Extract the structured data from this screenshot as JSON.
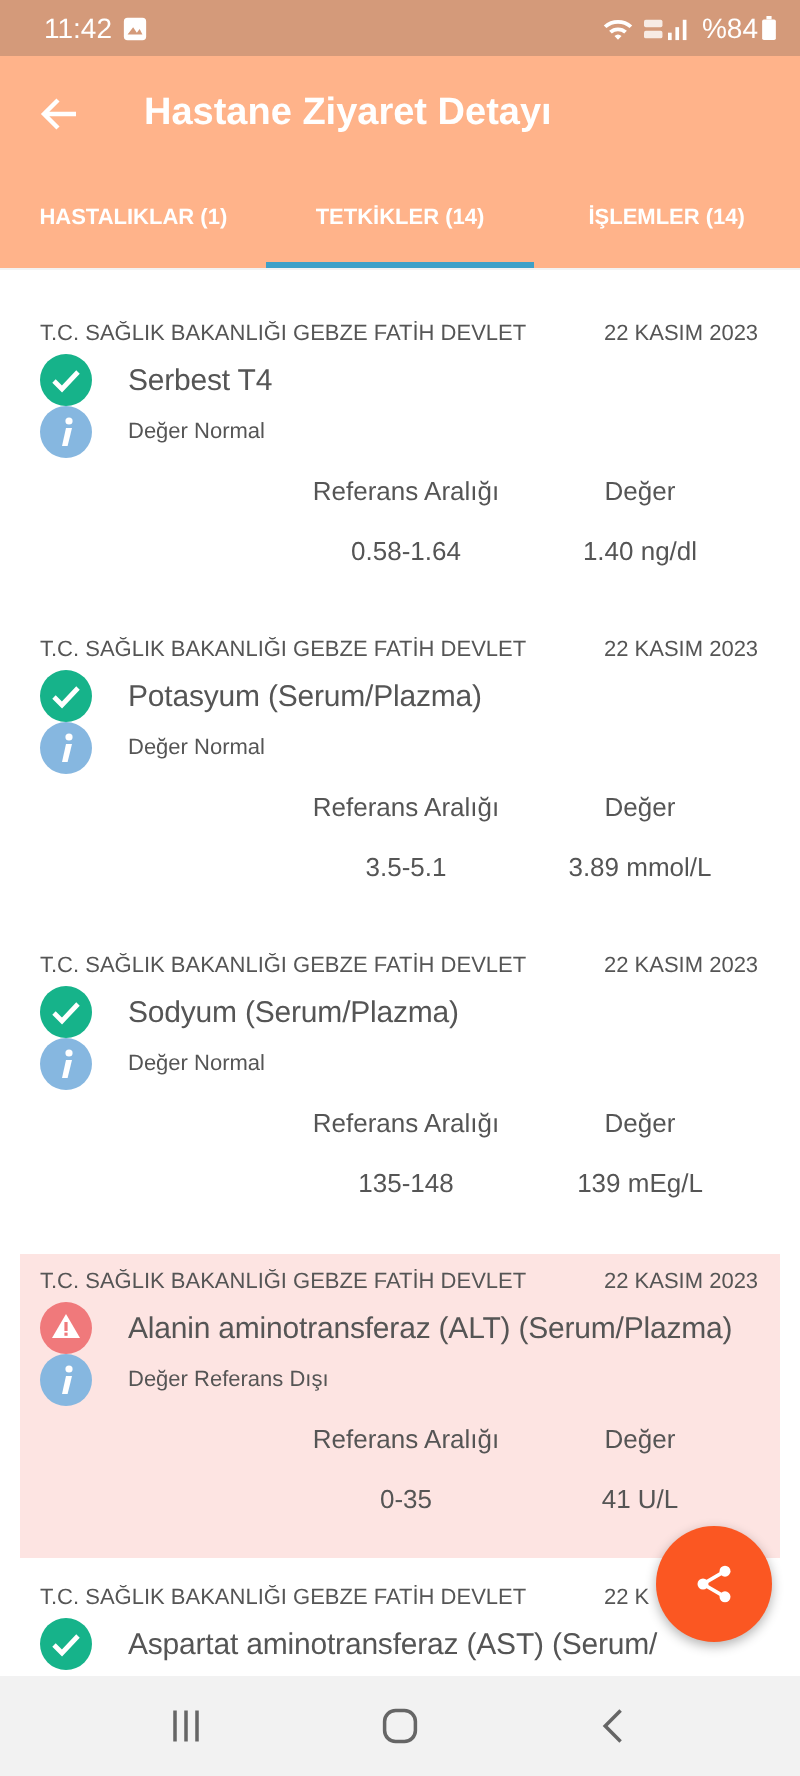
{
  "status_bar": {
    "time": "11:42",
    "battery": "%84"
  },
  "app_bar": {
    "title": "Hastane Ziyaret Detayı"
  },
  "tabs": [
    {
      "label": "HASTALIKLAR (1)",
      "selected": false
    },
    {
      "label": "TETKİKLER (14)",
      "selected": true
    },
    {
      "label": "İŞLEMLER (14)",
      "selected": false
    }
  ],
  "tests": [
    {
      "hospital": "T.C. SAĞLIK BAKANLIĞI GEBZE FATİH DEVLET",
      "date": "22 KASIM 2023",
      "name": "Serbest T4",
      "kind": "normal",
      "status_text": "Değer Normal",
      "range_label": "Referans Aralığı",
      "value_label": "Değer",
      "range": "0.58-1.64",
      "value": "1.40 ng/dl"
    },
    {
      "hospital": "T.C. SAĞLIK BAKANLIĞI GEBZE FATİH DEVLET",
      "date": "22 KASIM 2023",
      "name": "Potasyum (Serum/Plazma)",
      "kind": "normal",
      "status_text": "Değer Normal",
      "range_label": "Referans Aralığı",
      "value_label": "Değer",
      "range": "3.5-5.1",
      "value": "3.89 mmol/L"
    },
    {
      "hospital": "T.C. SAĞLIK BAKANLIĞI GEBZE FATİH DEVLET",
      "date": "22 KASIM 2023",
      "name": "Sodyum (Serum/Plazma)",
      "kind": "normal",
      "status_text": "Değer Normal",
      "range_label": "Referans Aralığı",
      "value_label": "Değer",
      "range": "135-148",
      "value": "139 mEg/L"
    },
    {
      "hospital": "T.C. SAĞLIK BAKANLIĞI GEBZE FATİH DEVLET",
      "date": "22 KASIM 2023",
      "name": "Alanin aminotransferaz (ALT) (Serum/Plazma)",
      "kind": "abnormal",
      "status_text": "Değer Referans Dışı",
      "range_label": "Referans Aralığı",
      "value_label": "Değer",
      "range": "0-35",
      "value": "41 U/L"
    },
    {
      "hospital": "T.C. SAĞLIK BAKANLIĞI GEBZE FATİH DEVLET",
      "date": "22 K",
      "name": "Aspartat aminotransferaz (AST) (Serum/",
      "kind": "normal"
    }
  ]
}
